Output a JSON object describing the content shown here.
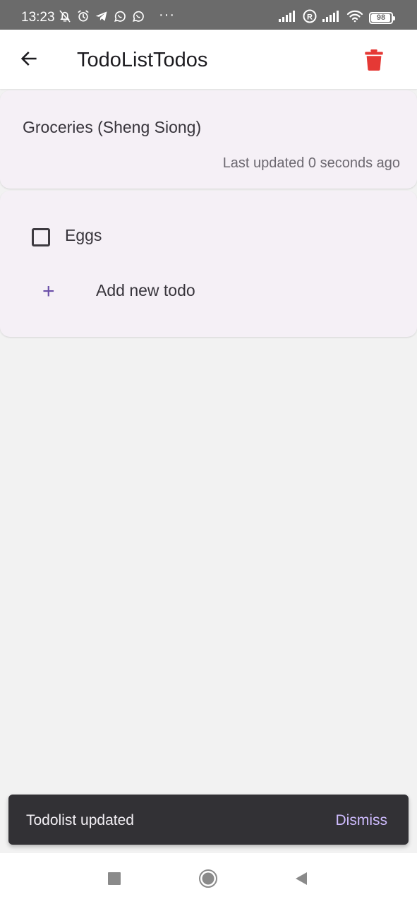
{
  "status_bar": {
    "time": "13:23",
    "more": "···",
    "battery_level": "98",
    "battery_fraction": 0.98,
    "icons_left": [
      "notifications-off-icon",
      "alarm-icon",
      "telegram-icon",
      "whatsapp-icon",
      "whatsapp-icon"
    ],
    "icons_right": [
      "signal-icon",
      "roaming-icon",
      "signal-icon",
      "wifi-icon",
      "battery-icon"
    ]
  },
  "app_bar": {
    "title": "TodoListTodos",
    "back_icon": "arrow-back-icon",
    "delete_icon": "trash-icon",
    "delete_color": "#e53935"
  },
  "list": {
    "name": "Groceries (Sheng Siong)",
    "last_updated": "Last updated 0 seconds ago"
  },
  "todos": [
    {
      "label": "Eggs",
      "checked": false
    }
  ],
  "add_todo": {
    "label": "Add new todo",
    "icon": "+"
  },
  "snackbar": {
    "message": "Todolist updated",
    "action": "Dismiss"
  },
  "nav_bar": {
    "buttons": [
      "recents-icon",
      "home-icon",
      "back-icon"
    ]
  },
  "colors": {
    "accent": "#6a4ea8",
    "card_background": "#f5f0f6",
    "page_background": "#f2f2f2",
    "snackbar_background": "#323135",
    "snackbar_action": "#cfbcff"
  }
}
